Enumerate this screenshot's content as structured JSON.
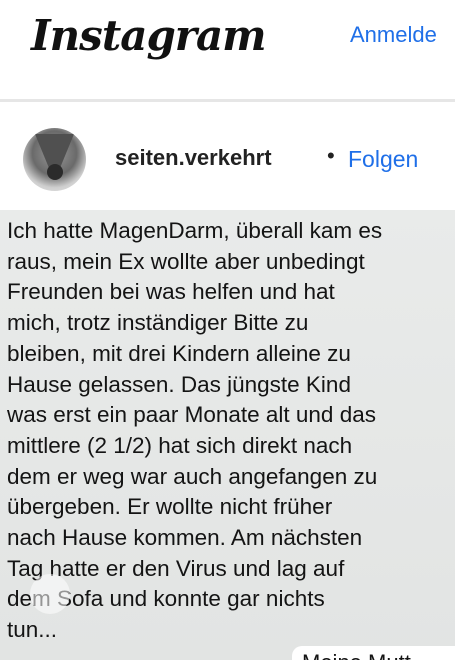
{
  "header": {
    "logo_text": "Instagram",
    "login_label": "Anmelde"
  },
  "post": {
    "username": "seiten.verkehrt",
    "separator": "•",
    "follow_label": "Folgen",
    "message_text": "Ich hatte MagenDarm, überall kam es\nraus, mein Ex wollte aber unbedingt\nFreunden bei was helfen und hat\nmich, trotz inständiger Bitte zu\nbleiben, mit drei Kindern alleine zu\nHause gelassen. Das jüngste Kind\nwas erst ein paar Monate alt und das\nmittlere (2 1/2) hat sich direkt nach\ndem er weg war auch angefangen zu\nübergeben. Er wollte nicht früher\nnach Hause kommen. Am nächsten\nTag hatte er den Virus und lag auf\ndem Sofa und konnte gar nichts\ntun...",
    "next_message_snippet": "Meine Mutt"
  },
  "colors": {
    "link_blue": "#1f6fe8",
    "divider": "#e6e6e6",
    "message_background": "#e6e8e7"
  },
  "icons": {
    "avatar": "profile-avatar-image"
  }
}
